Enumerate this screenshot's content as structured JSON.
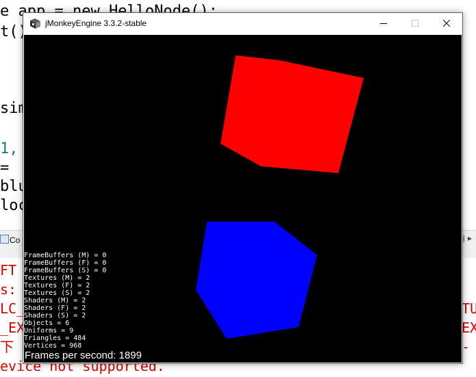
{
  "background_editor": {
    "lines": [
      "e app = new HelloNode();",
      "t();",
      "sim",
      "1,",
      "=",
      "blu",
      "loca"
    ],
    "console_lines": [
      "FT",
      "s:",
      "LC_",
      "_EX",
      "下",
      "evice not supported."
    ],
    "console_right": [
      "TU",
      "EX",
      "-"
    ],
    "console_tab_label": "Co",
    "console_icons": "▣ ▸"
  },
  "window": {
    "title": "jMonkeyEngine 3.3.2-stable",
    "controls": {
      "minimize_icon": "minimize-icon",
      "maximize_icon": "maximize-icon",
      "close_icon": "close-icon"
    }
  },
  "scene": {
    "objects": [
      {
        "name": "red-cube",
        "color": "#ff0000"
      },
      {
        "name": "blue-cube",
        "color": "#0000ff"
      }
    ],
    "background_color": "#000000"
  },
  "stats": {
    "lines": [
      "FrameBuffers (M) = 0",
      "FrameBuffers (F) = 0",
      "FrameBuffers (S) = 0",
      "Textures (M) = 2",
      "Textures (F) = 2",
      "Textures (S) = 2",
      "Shaders (M) = 2",
      "Shaders (F) = 2",
      "Shaders (S) = 2",
      "Objects = 6",
      "Uniforms = 9",
      "Triangles = 484",
      "Vertices = 968"
    ]
  },
  "fps": {
    "label": "Frames per second: 1899"
  }
}
